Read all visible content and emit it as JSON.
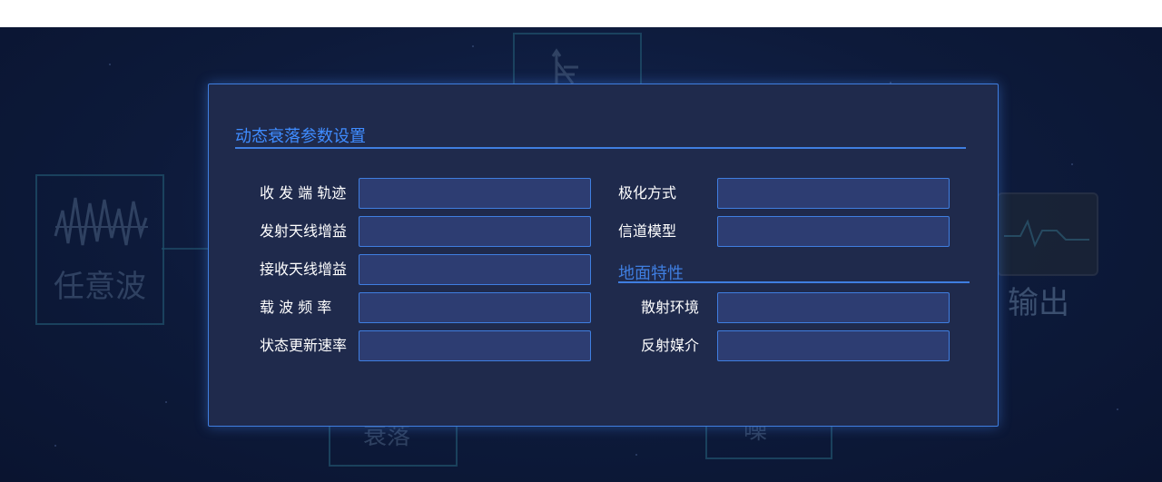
{
  "background": {
    "card_left_label": "任意波",
    "card_right_label": "输出",
    "card_bottom_left_label": "衰落",
    "card_bottom_right_label": "噪"
  },
  "dialog": {
    "title": "动态衰落参数设置",
    "left_fields": [
      {
        "label": "收 发 端 轨迹",
        "value": ""
      },
      {
        "label": "发射天线增益",
        "value": ""
      },
      {
        "label": "接收天线增益",
        "value": ""
      },
      {
        "label": "载  波  频  率",
        "value": ""
      },
      {
        "label": "状态更新速率",
        "value": ""
      }
    ],
    "right_fields": [
      {
        "label": "极化方式",
        "value": ""
      },
      {
        "label": "信道模型",
        "value": ""
      }
    ],
    "ground_section_title": "地面特性",
    "ground_fields": [
      {
        "label": "散射环境",
        "value": ""
      },
      {
        "label": "反射媒介",
        "value": ""
      }
    ]
  },
  "colors": {
    "accent": "#3f7ee0",
    "dialog_bg": "#1f2a4c",
    "field_bg": "#2d3d72"
  }
}
